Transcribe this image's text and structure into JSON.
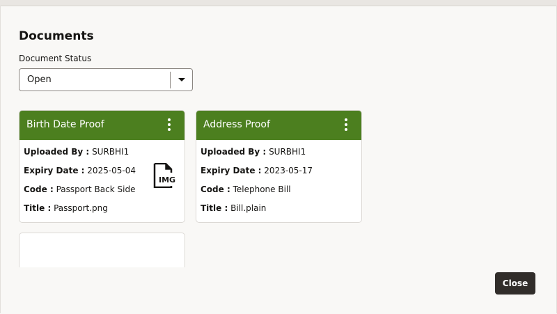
{
  "dialog": {
    "title": "Documents",
    "status_label": "Document Status",
    "status_value": "Open",
    "close_label": "Close"
  },
  "cards": [
    {
      "title": "Birth Date Proof",
      "uploaded_by_key": "Uploaded By :",
      "uploaded_by": "SURBHI1",
      "expiry_key": "Expiry Date :",
      "expiry": "2025-05-04",
      "code_key": "Code :",
      "code": "Passport Back Side",
      "title_key": "Title :",
      "file_title": "Passport.png",
      "icon": "img-file-icon",
      "icon_text": "IMG"
    },
    {
      "title": "Address Proof",
      "uploaded_by_key": "Uploaded By :",
      "uploaded_by": "SURBHI1",
      "expiry_key": "Expiry Date :",
      "expiry": "2023-05-17",
      "code_key": "Code :",
      "code": "Telephone Bill",
      "title_key": "Title :",
      "file_title": "Bill.plain"
    }
  ],
  "colors": {
    "card_header": "#4c7f1f",
    "close_button": "#312d2a",
    "background": "#f9f8f6"
  }
}
